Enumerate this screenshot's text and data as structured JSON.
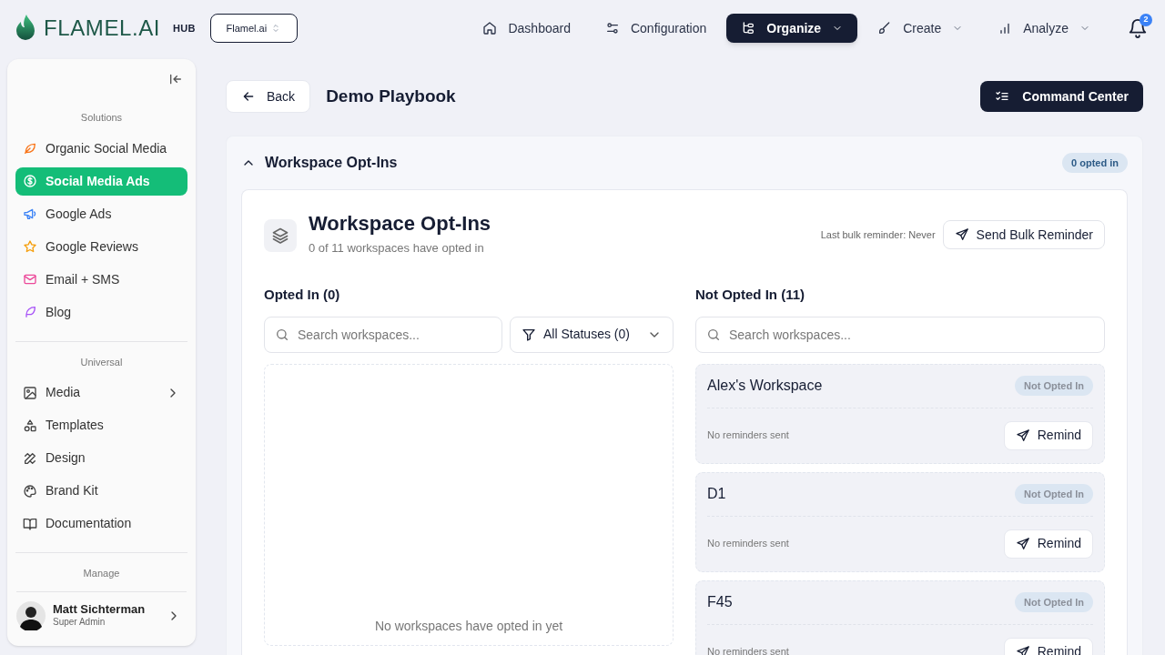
{
  "header": {
    "logo": "FLAMEL.AI",
    "hub_label": "HUB",
    "org_select": {
      "value": "Flamel.ai"
    },
    "nav": [
      {
        "label": "Dashboard",
        "selected": false,
        "has_menu": false
      },
      {
        "label": "Configuration",
        "selected": false,
        "has_menu": false
      },
      {
        "label": "Organize",
        "selected": true,
        "has_menu": true
      },
      {
        "label": "Create",
        "selected": false,
        "has_menu": true
      },
      {
        "label": "Analyze",
        "selected": false,
        "has_menu": true
      }
    ],
    "notifications": {
      "count": "2"
    }
  },
  "sidebar": {
    "sections": [
      {
        "heading": "Solutions",
        "items": [
          {
            "label": "Organic Social Media",
            "selected": false,
            "has_submenu": false
          },
          {
            "label": "Social Media Ads",
            "selected": true,
            "has_submenu": false
          },
          {
            "label": "Google Ads",
            "selected": false,
            "has_submenu": false
          },
          {
            "label": "Google Reviews",
            "selected": false,
            "has_submenu": false
          },
          {
            "label": "Email + SMS",
            "selected": false,
            "has_submenu": false
          },
          {
            "label": "Blog",
            "selected": false,
            "has_submenu": false
          }
        ]
      },
      {
        "heading": "Universal",
        "items": [
          {
            "label": "Media",
            "selected": false,
            "has_submenu": true
          },
          {
            "label": "Templates",
            "selected": false,
            "has_submenu": false
          },
          {
            "label": "Design",
            "selected": false,
            "has_submenu": false
          },
          {
            "label": "Brand Kit",
            "selected": false,
            "has_submenu": false
          },
          {
            "label": "Documentation",
            "selected": false,
            "has_submenu": false
          }
        ]
      },
      {
        "heading": "Manage"
      }
    ],
    "user": {
      "name": "Matt Sichterman",
      "role": "Super Admin"
    }
  },
  "page": {
    "back": "Back",
    "title": "Demo Playbook",
    "command_center": "Command Center"
  },
  "panel": {
    "title": "Workspace Opt-Ins",
    "expanded": true,
    "badge": "0 opted in",
    "card": {
      "title": "Workspace Opt-Ins",
      "subtitle": "0 of 11 workspaces have opted in",
      "last_reminder": "Last bulk reminder: Never",
      "bulk_button": "Send Bulk Reminder",
      "opted_in": {
        "heading": "Opted In (0)",
        "search": {
          "placeholder": "Search workspaces..."
        },
        "filter": "All Statuses (0)",
        "empty": "No workspaces have opted in yet"
      },
      "not_opted_in": {
        "heading": "Not Opted In (11)",
        "search": {
          "placeholder": "Search workspaces..."
        },
        "workspaces": [
          {
            "name": "Alex's Workspace",
            "status": "Not Opted In",
            "reminders": "No reminders sent",
            "action": "Remind"
          },
          {
            "name": "D1",
            "status": "Not Opted In",
            "reminders": "No reminders sent",
            "action": "Remind"
          },
          {
            "name": "F45",
            "status": "Not Opted In",
            "reminders": "No reminders sent",
            "action": "Remind"
          }
        ]
      }
    }
  }
}
